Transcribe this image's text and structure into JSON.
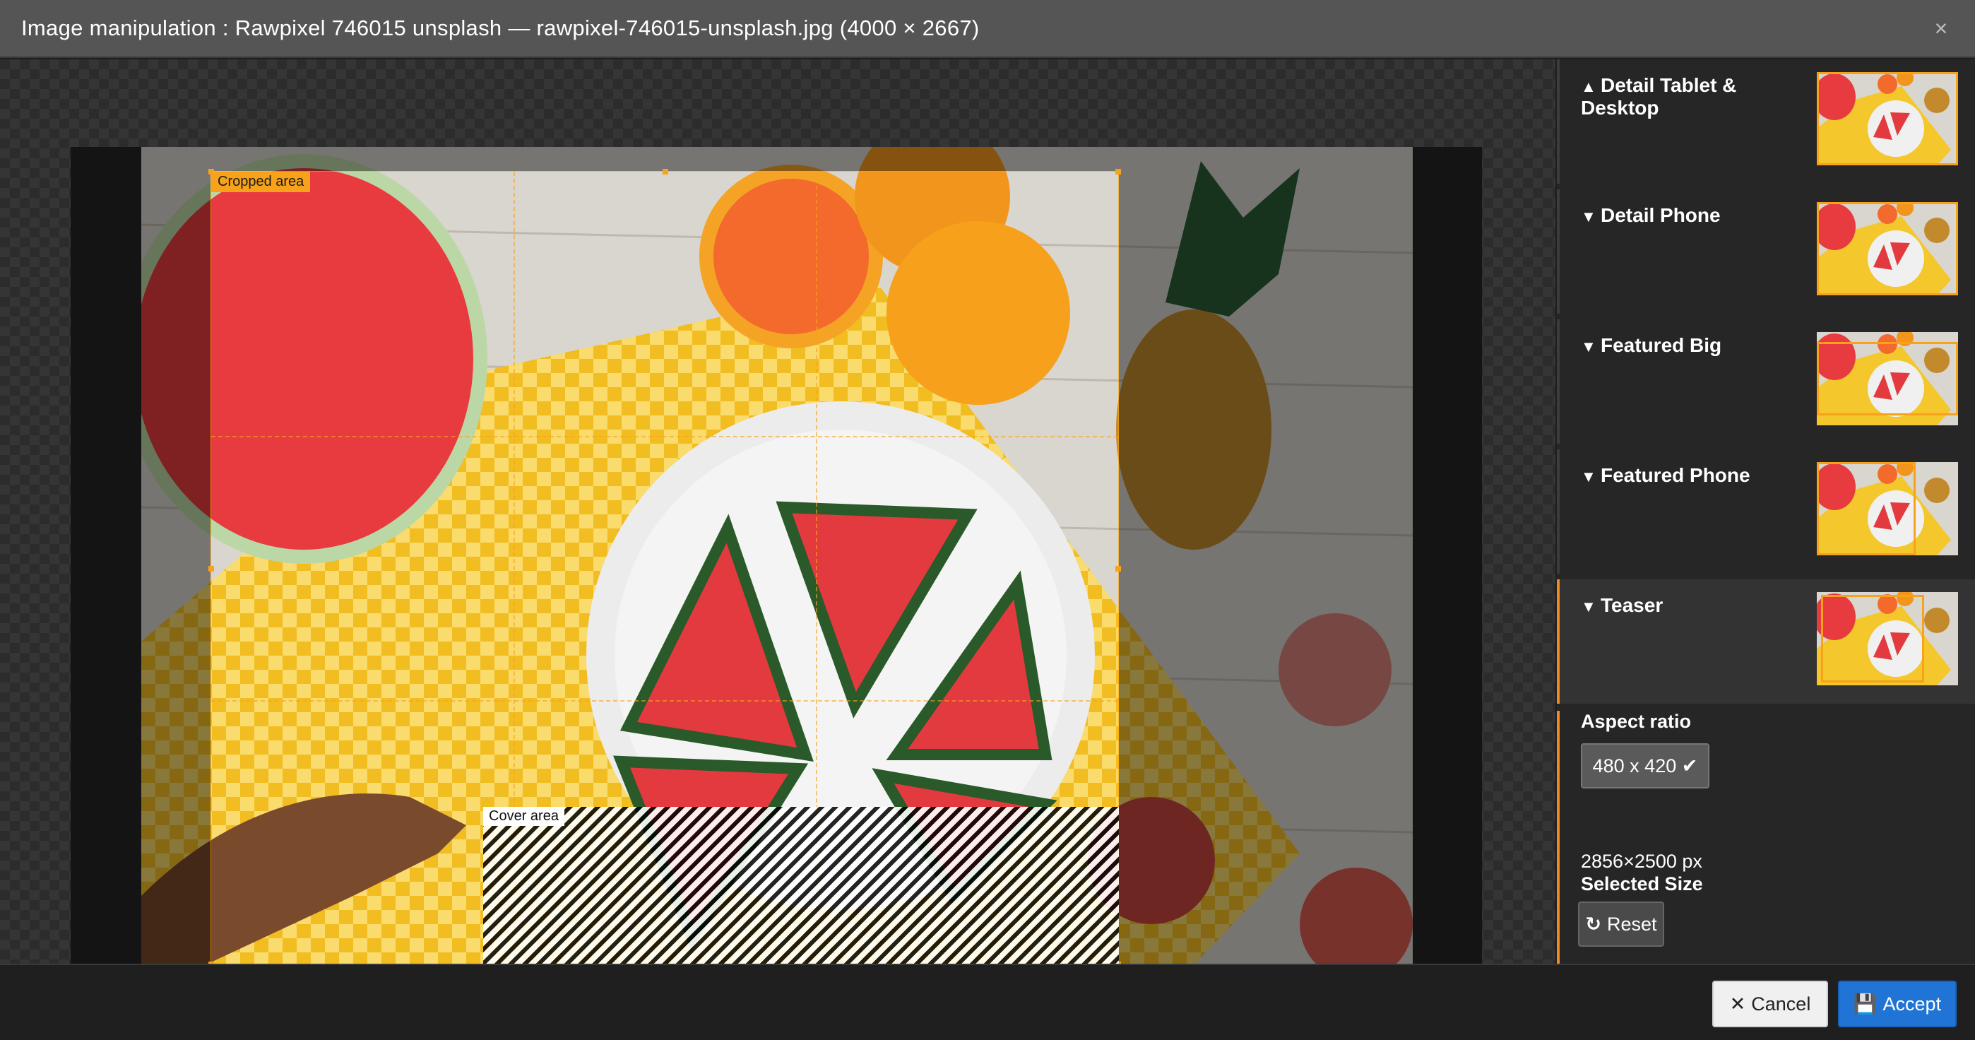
{
  "header": {
    "title": "Image manipulation : Rawpixel 746015 unsplash — rawpixel-746015-unsplash.jpg (4000 × 2667)",
    "close_icon": "close-icon",
    "close_glyph": "×"
  },
  "editor": {
    "cropped_area_label": "Cropped area",
    "cover_area_label": "Cover area",
    "colors": {
      "crop_accent": "#f7a21a",
      "cover_stripe_dark": "#000000",
      "cover_stripe_light": "#ffffff"
    }
  },
  "variants": [
    {
      "label": "Detail Tablet & Desktop",
      "chevron": "▲",
      "expanded": true
    },
    {
      "label": "Detail Phone",
      "chevron": "▼",
      "expanded": false
    },
    {
      "label": "Featured Big",
      "chevron": "▼",
      "expanded": false
    },
    {
      "label": "Featured Phone",
      "chevron": "▼",
      "expanded": false
    },
    {
      "label": "Teaser",
      "chevron": "▼",
      "expanded": false,
      "active": true
    }
  ],
  "settings": {
    "aspect_ratio_label": "Aspect ratio",
    "aspect_ratio_value": "480 x 420",
    "aspect_ratio_check": "✔",
    "selected_size_label": "Selected Size",
    "selected_size_value": "2856×2500 px",
    "reset_label": "Reset",
    "reset_icon": "↻"
  },
  "footer": {
    "cancel_label": "Cancel",
    "cancel_icon": "✕",
    "accept_label": "Accept",
    "accept_icon": "💾"
  },
  "colors": {
    "accent_orange": "#f08a24",
    "primary_blue": "#1f74d6",
    "header_bg": "#555555"
  }
}
